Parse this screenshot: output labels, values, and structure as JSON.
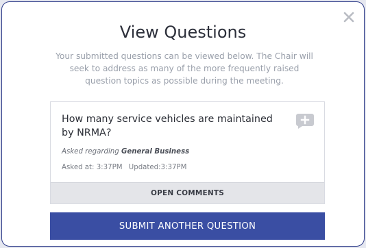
{
  "modal": {
    "title": "View Questions",
    "subtitle": "Your submitted questions can be viewed below. The Chair will seek to address as many of the more frequently raised question topics as possible during the meeting.",
    "close_icon": "close-icon"
  },
  "question_card": {
    "text": "How many service vehicles are maintained by NRMA?",
    "asked_regarding_prefix": "Asked regarding",
    "topic": "General Business",
    "asked_at": "Asked at: 3:37PM",
    "updated": "Updated:3:37PM",
    "comment_icon": "add-comment-icon",
    "open_comments_label": "OPEN COMMENTS"
  },
  "submit_label": "SUBMIT ANOTHER QUESTION",
  "colors": {
    "primary": "#3a4ea3",
    "comment_icon": "#c8cad0",
    "text": "#2b2e36",
    "muted": "#9aa0ab"
  }
}
